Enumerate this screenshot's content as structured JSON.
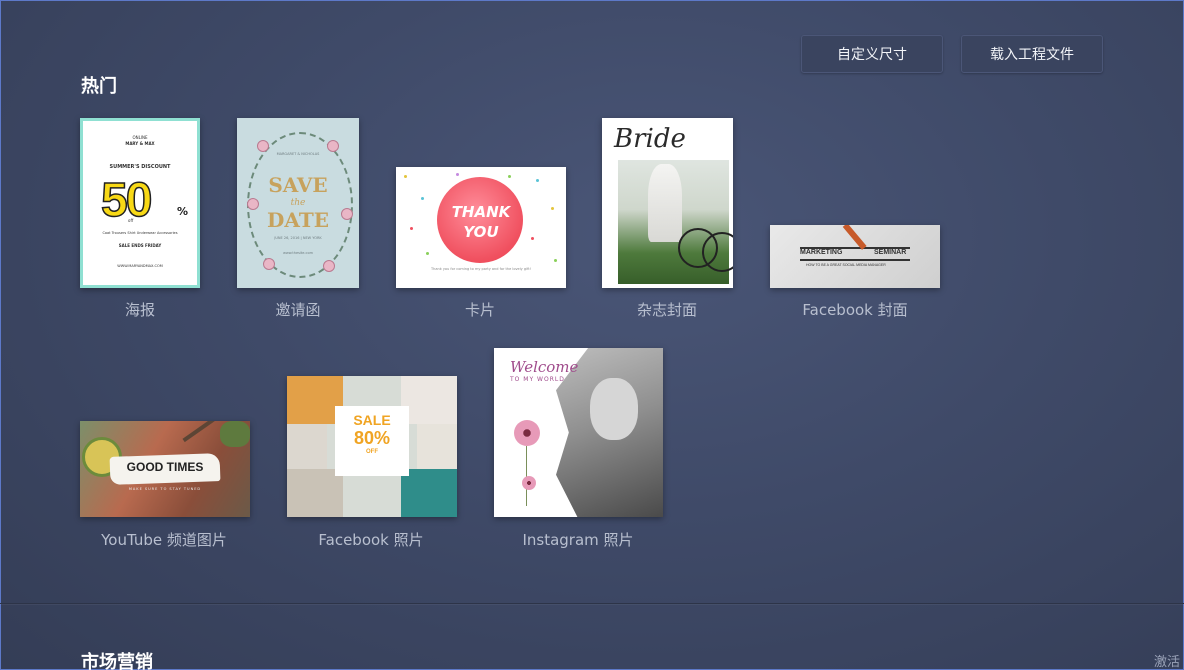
{
  "toolbar": {
    "custom_size_label": "自定义尺寸",
    "load_project_label": "载入工程文件"
  },
  "sections": {
    "hot_title": "热门",
    "marketing_title": "市场营销"
  },
  "templates": {
    "poster": {
      "label": "海报",
      "thumb_top": "ONLINE",
      "thumb_brand": "MARY & MAX",
      "thumb_headline": "SUMMER'S DISCOUNT",
      "thumb_big": "50",
      "thumb_pct": "%",
      "thumb_off": "off",
      "thumb_items": "Coat   Trousers   Shirt   Underwear   Accessories",
      "thumb_sale": "SALE ENDS FRIDAY",
      "thumb_footer": "WWW.MARYANDMAX.COM"
    },
    "invitation": {
      "label": "邀请函",
      "thumb_names": "MARGARET & NICHOLAS",
      "thumb_save": "SAVE",
      "thumb_the": "the",
      "thumb_date": "DATE",
      "thumb_when": "JUNE 26, 2016 | NEW YORK",
      "thumb_footer": "www.thesite.com"
    },
    "card": {
      "label": "卡片",
      "thumb_line1": "THANK",
      "thumb_line2": "YOU",
      "thumb_note": "Thank you for coming to my party and for the lovely gift!"
    },
    "magazine": {
      "label": "杂志封面",
      "thumb_title": "Bride"
    },
    "facebook_cover": {
      "label": "Facebook 封面",
      "thumb_left": "MARKETING",
      "thumb_right": "SEMINAR",
      "thumb_sub": "HOW TO BE A GREAT SOCIAL MEDIA MANAGER"
    },
    "youtube": {
      "label": "YouTube 频道图片",
      "thumb_text": "GOOD TIMES",
      "thumb_sub": "MAKE SURE TO STAY TUNED"
    },
    "facebook_photo": {
      "label": "Facebook 照片",
      "thumb_sale": "SALE",
      "thumb_pct": "80%",
      "thumb_off": "OFF"
    },
    "instagram": {
      "label": "Instagram 照片",
      "thumb_title": "Welcome",
      "thumb_sub": "TO MY WORLD"
    }
  },
  "corner_text": "激活"
}
